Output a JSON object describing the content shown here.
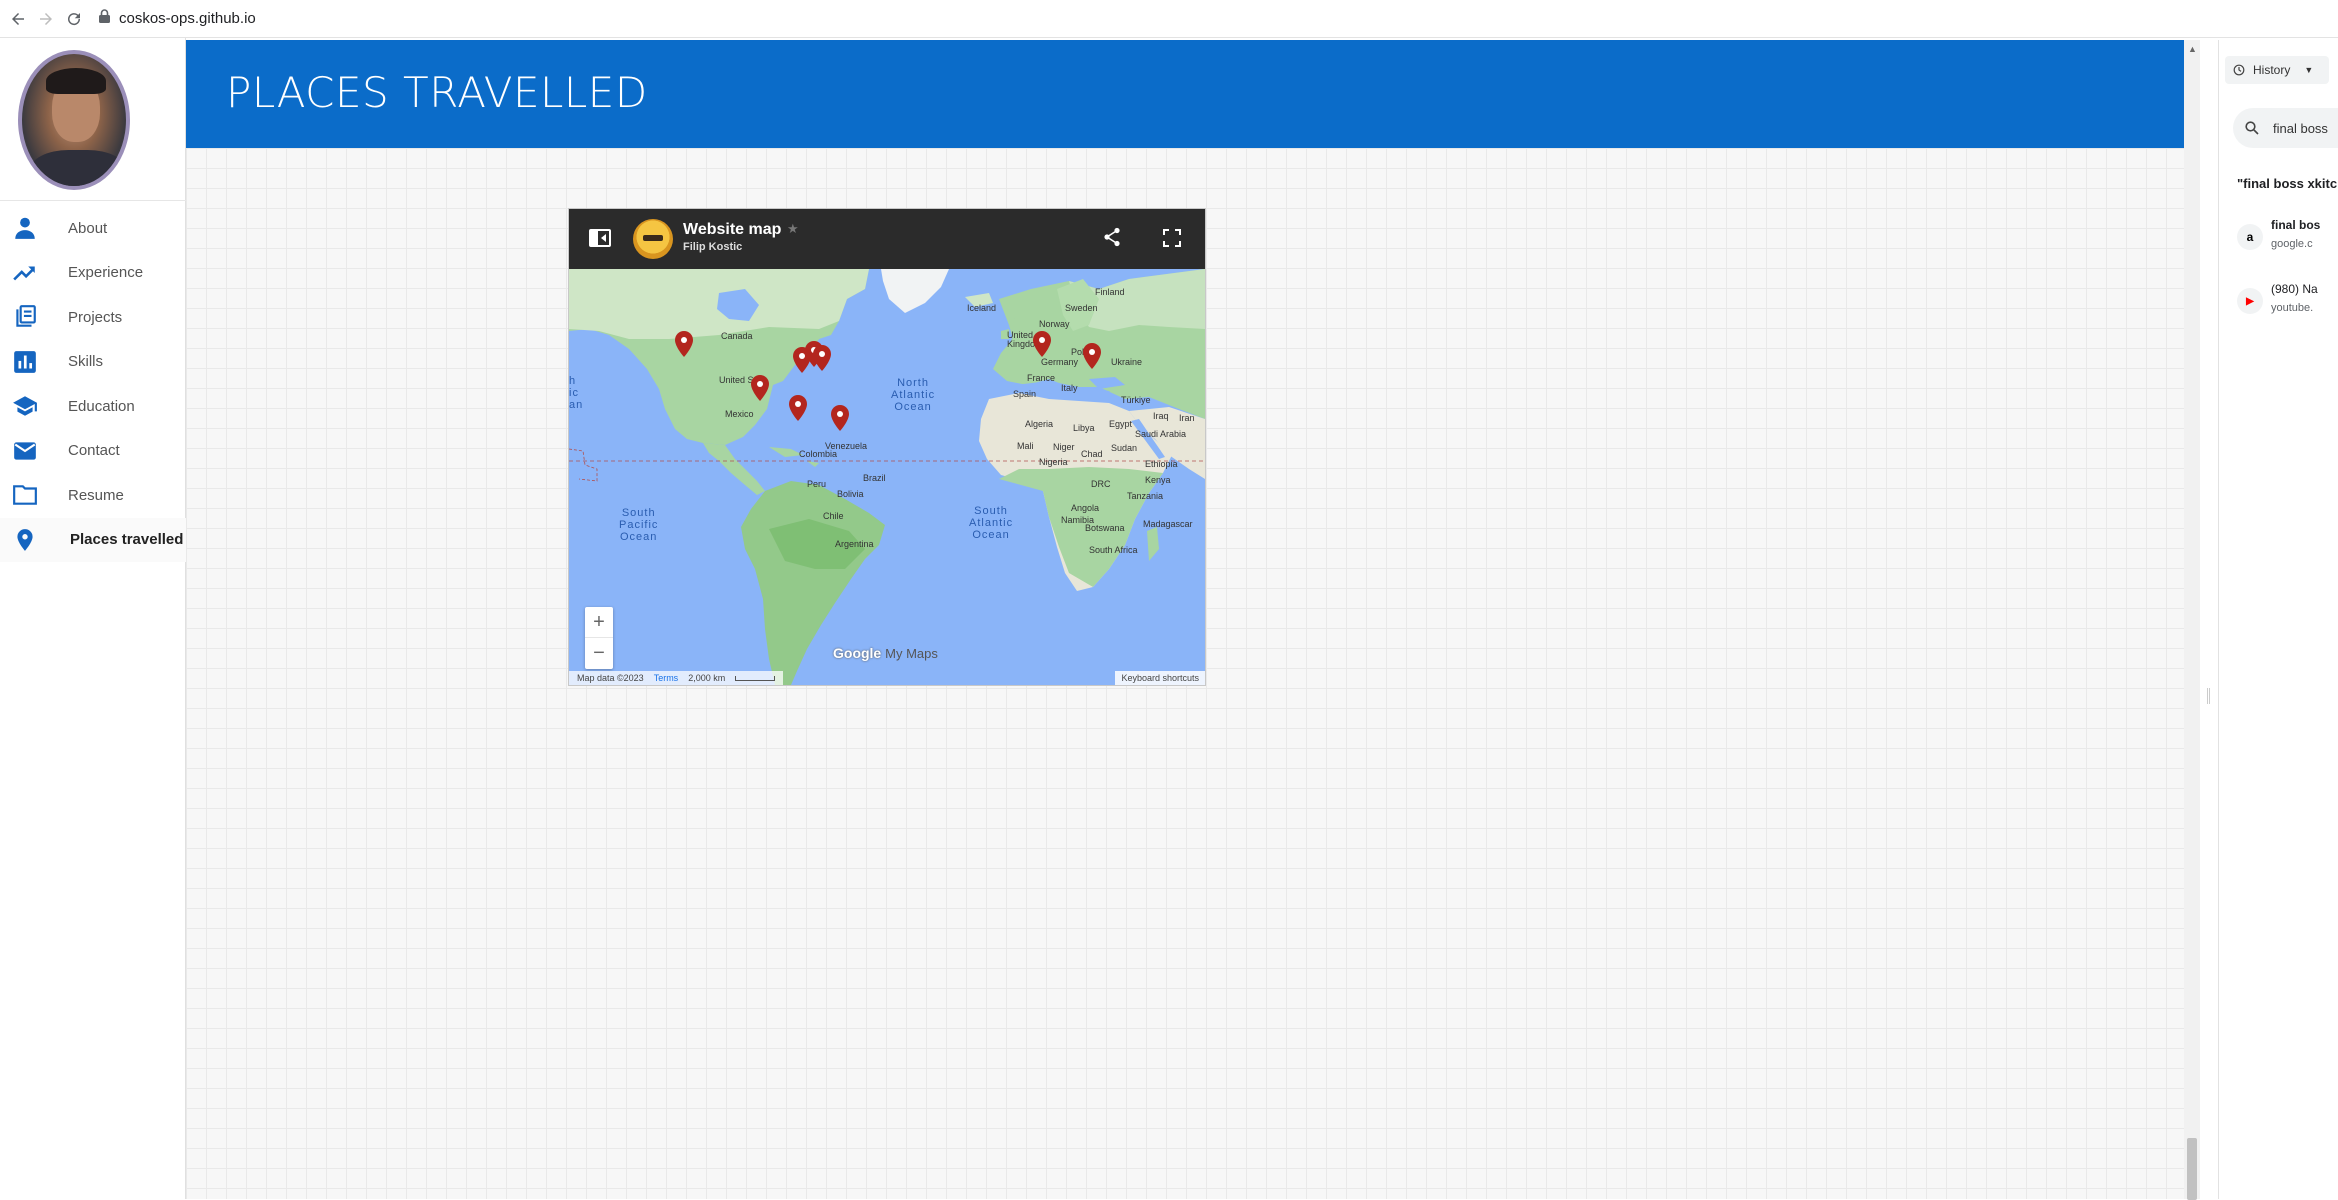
{
  "browser": {
    "url": "coskos-ops.github.io"
  },
  "sidebar": {
    "items": [
      {
        "label": "About",
        "icon": "person-icon"
      },
      {
        "label": "Experience",
        "icon": "trending-up-icon"
      },
      {
        "label": "Projects",
        "icon": "projects-icon"
      },
      {
        "label": "Skills",
        "icon": "bar-chart-icon"
      },
      {
        "label": "Education",
        "icon": "school-icon"
      },
      {
        "label": "Contact",
        "icon": "mail-icon"
      },
      {
        "label": "Resume",
        "icon": "folder-icon"
      },
      {
        "label": "Places travelled",
        "icon": "location-pin-icon",
        "active": true
      }
    ]
  },
  "header": {
    "title": "PLACES TRAVELLED",
    "color": "#0b6cc9"
  },
  "map": {
    "title": "Website map",
    "owner": "Filip Kostic",
    "labels": {
      "iceland": "Iceland",
      "finland": "Finland",
      "sweden": "Sweden",
      "norway": "Norway",
      "uk": "United Kingdom",
      "poland": "Poland",
      "germany": "Germany",
      "ukraine": "Ukraine",
      "france": "France",
      "italy": "Italy",
      "spain": "Spain",
      "turkiye": "Türkiye",
      "iraq": "Iraq",
      "iran": "Iran",
      "algeria": "Algeria",
      "libya": "Libya",
      "egypt": "Egypt",
      "saudi": "Saudi Arabia",
      "mali": "Mali",
      "niger": "Niger",
      "chad": "Chad",
      "sudan": "Sudan",
      "nigeria": "Nigeria",
      "ethiopia": "Ethiopia",
      "drc": "DRC",
      "kenya": "Kenya",
      "tanzania": "Tanzania",
      "angola": "Angola",
      "namibia": "Namibia",
      "botswana": "Botswana",
      "madagascar": "Madagascar",
      "south_africa": "South Africa",
      "canada": "Canada",
      "us": "United S",
      "mexico": "Mexico",
      "venezuela": "Venezuela",
      "colombia": "Colombia",
      "brazil": "Brazil",
      "peru": "Peru",
      "bolivia": "Bolivia",
      "chile": "Chile",
      "argentina": "Argentina"
    },
    "oceans": {
      "north_atlantic": "North\nAtlantic\nOcean",
      "south_atlantic": "South\nAtlantic\nOcean",
      "south_pacific": "South\nPacific\nOcean",
      "pacific_left": "h\nic\nan"
    },
    "zoom_in": "+",
    "zoom_out": "−",
    "logo_google": "Google",
    "logo_mymaps": "My Maps",
    "map_data": "Map data ©2023",
    "terms": "Terms",
    "scale": "2,000 km",
    "keyboard_shortcuts": "Keyboard shortcuts",
    "pin_color": "#b3261e"
  },
  "side_panel": {
    "history_label": "History",
    "search_query": "final boss",
    "query_title": "\"final boss xkitc",
    "results": [
      {
        "title": "final bos",
        "url": "google.c",
        "favicon": "a",
        "icon": "amazon-icon"
      },
      {
        "title": "(980) Na",
        "url": "youtube.",
        "favicon": "▶",
        "icon": "youtube-icon"
      }
    ]
  }
}
